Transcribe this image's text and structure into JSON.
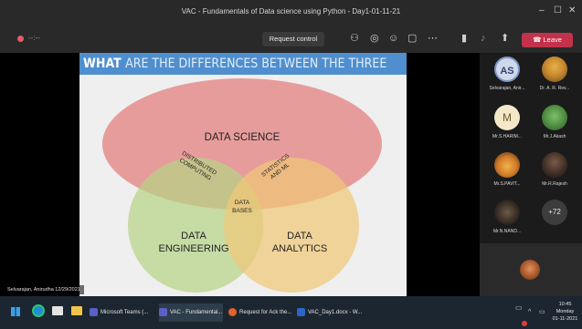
{
  "window": {
    "title": "VAC - Fundamentals of Data science using Python - Day1-01-11-21",
    "minimize": "–",
    "maximize": "☐",
    "close": "✕"
  },
  "toolbar": {
    "timer": "--:--",
    "request_control": "Request control",
    "leave": "Leave"
  },
  "slide": {
    "heading_strong": "WHAT",
    "heading_rest": "ARE THE DIFFERENCES BETWEEN THE THREE",
    "circle_science": "DATA SCIENCE",
    "circle_engineering_1": "DATA",
    "circle_engineering_2": "ENGINEERING",
    "circle_analytics_1": "DATA",
    "circle_analytics_2": "ANALYTICS",
    "overlap_distributed_1": "DISTRIBUTED",
    "overlap_distributed_2": "COMPUTING",
    "overlap_stats_1": "STATISTICS",
    "overlap_stats_2": "AND ML",
    "overlap_center_1": "DATA",
    "overlap_center_2": "BASES"
  },
  "presenter_label": "Selvarajan, Anirudha 12/29/2021",
  "participants": [
    {
      "initials": "AS",
      "name": "Selvarajan, Anir..."
    },
    {
      "initials": "",
      "name": "Dr. A. R. Rev..."
    },
    {
      "initials": "M",
      "name": "Mr.S.HARIM..."
    },
    {
      "initials": "",
      "name": "Mr.J.Akash"
    },
    {
      "initials": "",
      "name": "Mr.S.PAVIT..."
    },
    {
      "initials": "",
      "name": "Mr.R.Rajesh"
    },
    {
      "initials": "",
      "name": "Mr.N.NAND..."
    },
    {
      "initials": "+72",
      "name": ""
    }
  ],
  "taskbar": {
    "items": [
      {
        "label": "Microsoft Teams (..."
      },
      {
        "label": "VAC - Fundamental..."
      },
      {
        "label": "Request for Ack the..."
      },
      {
        "label": "VAC_Day1.docx - W..."
      }
    ],
    "time": "10:45",
    "day": "Monday",
    "date": "01-11-2021"
  },
  "colors": {
    "science": "#e58a8a",
    "engineering": "#b7d287",
    "analytics": "#f0c777",
    "accent": "#4f8fcf",
    "leave": "#c4314b"
  }
}
